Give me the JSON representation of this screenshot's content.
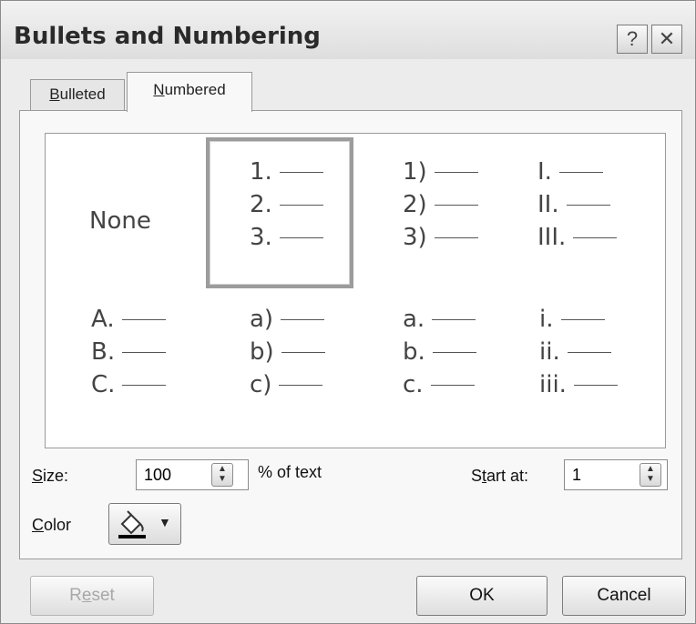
{
  "window": {
    "title": "Bullets and Numbering",
    "help_label": "?",
    "close_label": "✕"
  },
  "tabs": [
    {
      "label": "Bulleted",
      "accesskey": "B",
      "rest": "ulleted",
      "active": false
    },
    {
      "label": "Numbered",
      "accesskey": "N",
      "rest": "umbered",
      "active": true
    }
  ],
  "gallery": {
    "none_label": "None",
    "styles": [
      {
        "name": "arabic-period",
        "lines": [
          "1.",
          "2.",
          "3."
        ],
        "selected": true
      },
      {
        "name": "arabic-paren",
        "lines": [
          "1)",
          "2)",
          "3)"
        ],
        "selected": false
      },
      {
        "name": "upper-roman",
        "lines": [
          "I.",
          "II.",
          "III."
        ],
        "selected": false
      },
      {
        "name": "upper-alpha",
        "lines": [
          "A.",
          "B.",
          "C."
        ],
        "selected": false
      },
      {
        "name": "lower-alpha-paren",
        "lines": [
          "a)",
          "b)",
          "c)"
        ],
        "selected": false
      },
      {
        "name": "lower-alpha-period",
        "lines": [
          "a.",
          "b.",
          "c."
        ],
        "selected": false
      },
      {
        "name": "lower-roman",
        "lines": [
          "i.",
          "ii.",
          "iii."
        ],
        "selected": false
      }
    ]
  },
  "size": {
    "label_key": "S",
    "label_rest": "ize:",
    "value": "100",
    "suffix": "% of text"
  },
  "start_at": {
    "label_pre": "S",
    "label_key": "t",
    "label_rest": "art at:",
    "value": "1"
  },
  "color": {
    "label_key": "C",
    "label_rest": "olor",
    "swatch": "#000000",
    "icon": "paint-bucket-icon"
  },
  "buttons": {
    "reset": {
      "key_pre": "R",
      "key": "e",
      "rest": "set",
      "enabled": false
    },
    "ok": "OK",
    "cancel": "Cancel"
  }
}
